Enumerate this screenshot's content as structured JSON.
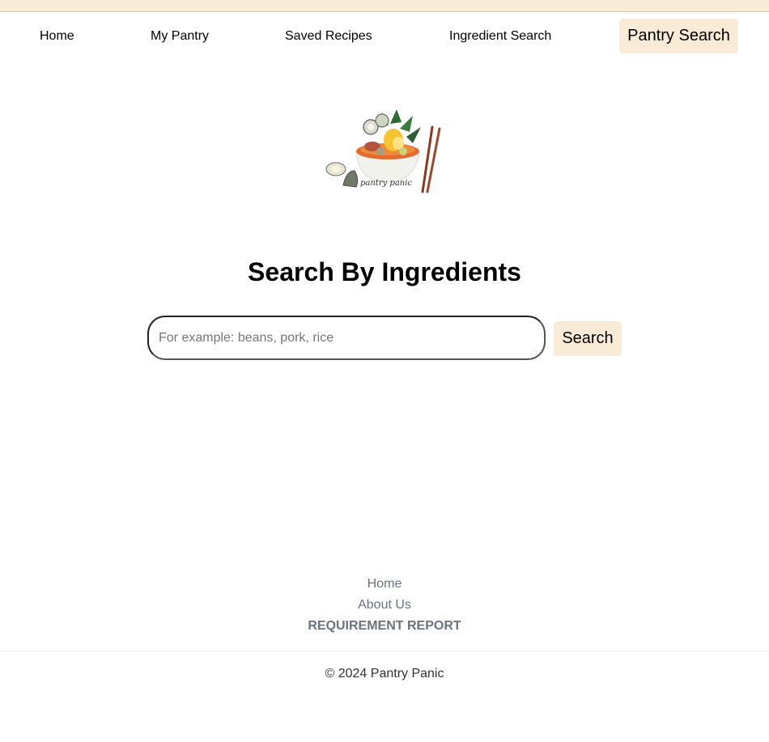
{
  "nav": {
    "items": [
      "Home",
      "My Pantry",
      "Saved Recipes",
      "Ingredient Search"
    ],
    "cta": "Pantry Search"
  },
  "logo": {
    "text": "pantry panic"
  },
  "main": {
    "title": "Search By Ingredients",
    "search_placeholder": "For example: beans, pork, rice",
    "search_value": "",
    "search_button": "Search"
  },
  "footer": {
    "links": [
      "Home",
      "About Us",
      "REQUIREMENT REPORT"
    ],
    "copyright": "© 2024 Pantry Panic"
  },
  "colors": {
    "accent": "#faebd7",
    "footer_link": "#6b7280"
  }
}
